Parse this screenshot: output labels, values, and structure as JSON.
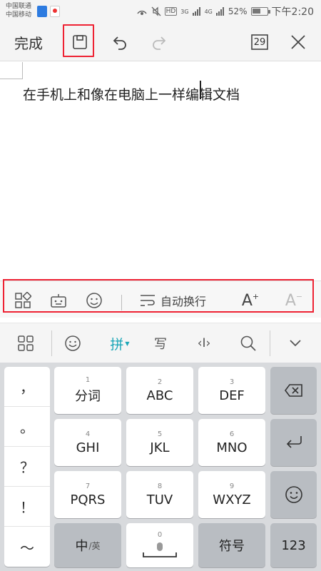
{
  "status_bar": {
    "carrier_1": "中国联通",
    "carrier_2": "中国移动",
    "sim_icons": [
      "shield-icon",
      "map-pin-icon"
    ],
    "hd": "HD",
    "net1": "3G",
    "net2": "4G",
    "battery_pct": "52%",
    "time": "下午2:20"
  },
  "editor_toolbar": {
    "done_label": "完成",
    "page_count": "29",
    "icons": [
      "save-icon",
      "undo-icon",
      "redo-icon",
      "page-count-icon",
      "close-icon"
    ]
  },
  "document": {
    "text": "在手机上和像在电脑上一样编辑文档"
  },
  "format_toolbar": {
    "wrap_label": "自动换行",
    "font_up": "A",
    "font_up_sup": "+",
    "font_down": "A",
    "font_down_sup": "−",
    "icons": [
      "grid-icon",
      "keyboard-robot-icon",
      "emoji-icon",
      "wrap-icon"
    ]
  },
  "ime_toolbar": {
    "pinyin": "拼",
    "write": "写",
    "cursor": "‹I›",
    "icons": [
      "apps-grid-icon",
      "smile-icon",
      "search-icon",
      "chevron-down-icon"
    ]
  },
  "keyboard": {
    "symbols": [
      "，",
      "。",
      "？",
      "！",
      "～"
    ],
    "keys": [
      {
        "num": "1",
        "label": "分词"
      },
      {
        "num": "2",
        "label": "ABC"
      },
      {
        "num": "3",
        "label": "DEF"
      },
      {
        "num": "4",
        "label": "GHI"
      },
      {
        "num": "5",
        "label": "JKL"
      },
      {
        "num": "6",
        "label": "MNO"
      },
      {
        "num": "7",
        "label": "PQRS"
      },
      {
        "num": "8",
        "label": "TUV"
      },
      {
        "num": "9",
        "label": "WXYZ"
      }
    ],
    "zh_label": "中",
    "en_sub": "/英",
    "space_num": "0",
    "symbol_label": "符号",
    "num_label": "123"
  },
  "colors": {
    "highlight": "#ee2233",
    "pinyin_accent": "#1aa6b7"
  }
}
